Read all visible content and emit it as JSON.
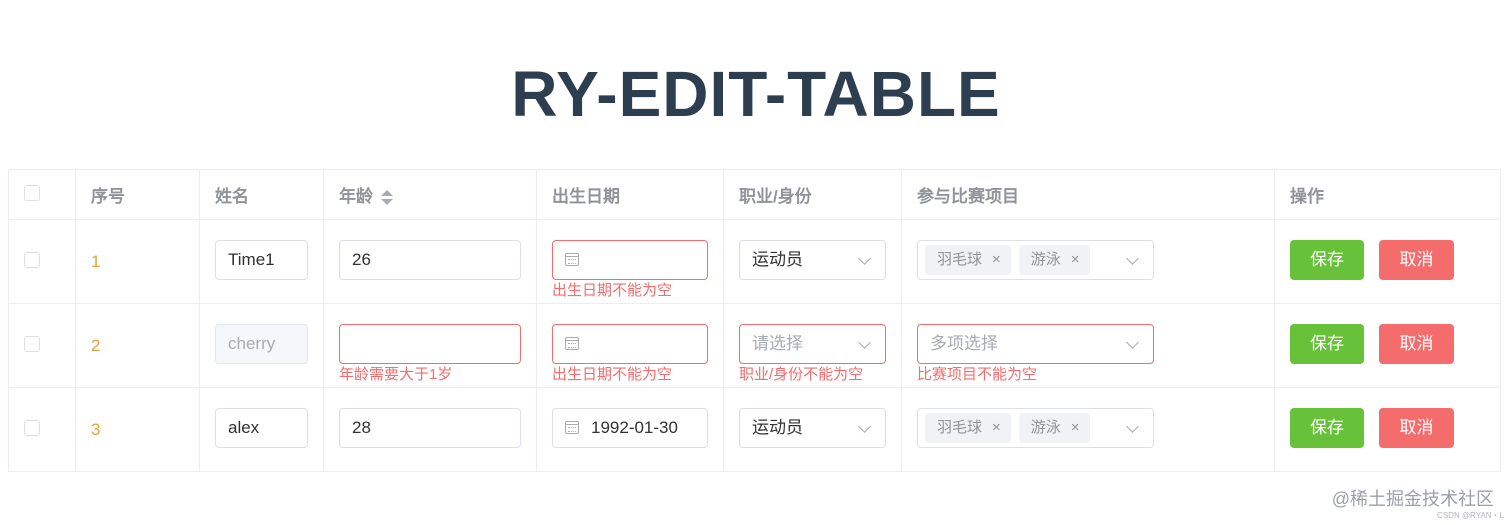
{
  "page_title": "RY-EDIT-TABLE",
  "columns": {
    "index": "序号",
    "name": "姓名",
    "age": "年龄",
    "birth": "出生日期",
    "job": "职业/身份",
    "events": "参与比赛项目",
    "actions": "操作"
  },
  "rows": [
    {
      "index": "1",
      "name": "Time1",
      "age": "26",
      "birth": "",
      "birth_error": "出生日期不能为空",
      "job": "运动员",
      "events": [
        "羽毛球",
        "游泳"
      ]
    },
    {
      "index": "2",
      "name": "cherry",
      "age": "",
      "age_error": "年龄需要大于1岁",
      "birth": "",
      "birth_error": "出生日期不能为空",
      "job_placeholder": "请选择",
      "job_error": "职业/身份不能为空",
      "events_placeholder": "多项选择",
      "events_error": "比赛项目不能为空"
    },
    {
      "index": "3",
      "name": "alex",
      "age": "28",
      "birth": "1992-01-30",
      "job": "运动员",
      "events": [
        "羽毛球",
        "游泳"
      ]
    }
  ],
  "actions": {
    "save": "保存",
    "cancel": "取消"
  },
  "tag_close": "×",
  "watermark": "@稀土掘金技术社区",
  "watermark_small": "CSDN @RYAN・L",
  "colors": {
    "title": "#2c3e50",
    "index": "#e6a23c",
    "save": "#67c23a",
    "cancel": "#f56c6c",
    "error": "#f56c6c"
  }
}
